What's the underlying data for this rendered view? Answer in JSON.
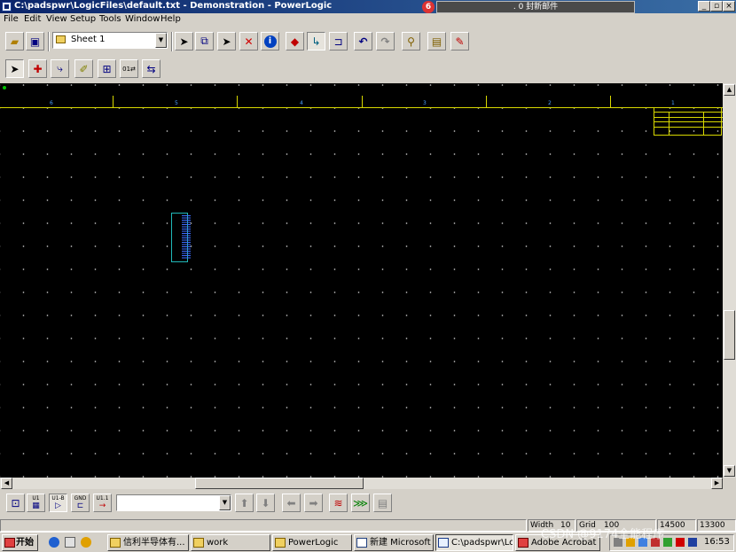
{
  "window": {
    "title": "C:\\padspwr\\LogicFiles\\default.txt - Demonstration - PowerLogic",
    "notification": ". 0 封新邮件",
    "caption_buttons": [
      "_",
      "▫",
      "×"
    ]
  },
  "menu": [
    "File",
    "Edit",
    "View",
    "Setup",
    "Tools",
    "Window",
    "Help"
  ],
  "toolbar": {
    "sheet_combo_value": "Sheet 1"
  },
  "canvas": {
    "zone_numbers": [
      "6",
      "5",
      "4",
      "3",
      "2",
      "1"
    ]
  },
  "bottom_toolbar": {
    "labels": [
      "U1",
      "U1-B",
      "GND",
      "U1.1"
    ],
    "combo_value": ""
  },
  "status": {
    "width_label": "Width",
    "width_value": "10",
    "grid_label": "Grid",
    "grid_value": "100",
    "x_coord": "14500",
    "y_coord": "13300"
  },
  "taskbar": {
    "start": "开始",
    "tasks": [
      "信利半导体有...",
      "work",
      "PowerLogic",
      "新建 Microsoft ...",
      "C:\\padspwr\\Lo...",
      "Adobe Acrobat ..."
    ],
    "clock": "16:53"
  },
  "watermark": "CSDN @9174全能程序"
}
